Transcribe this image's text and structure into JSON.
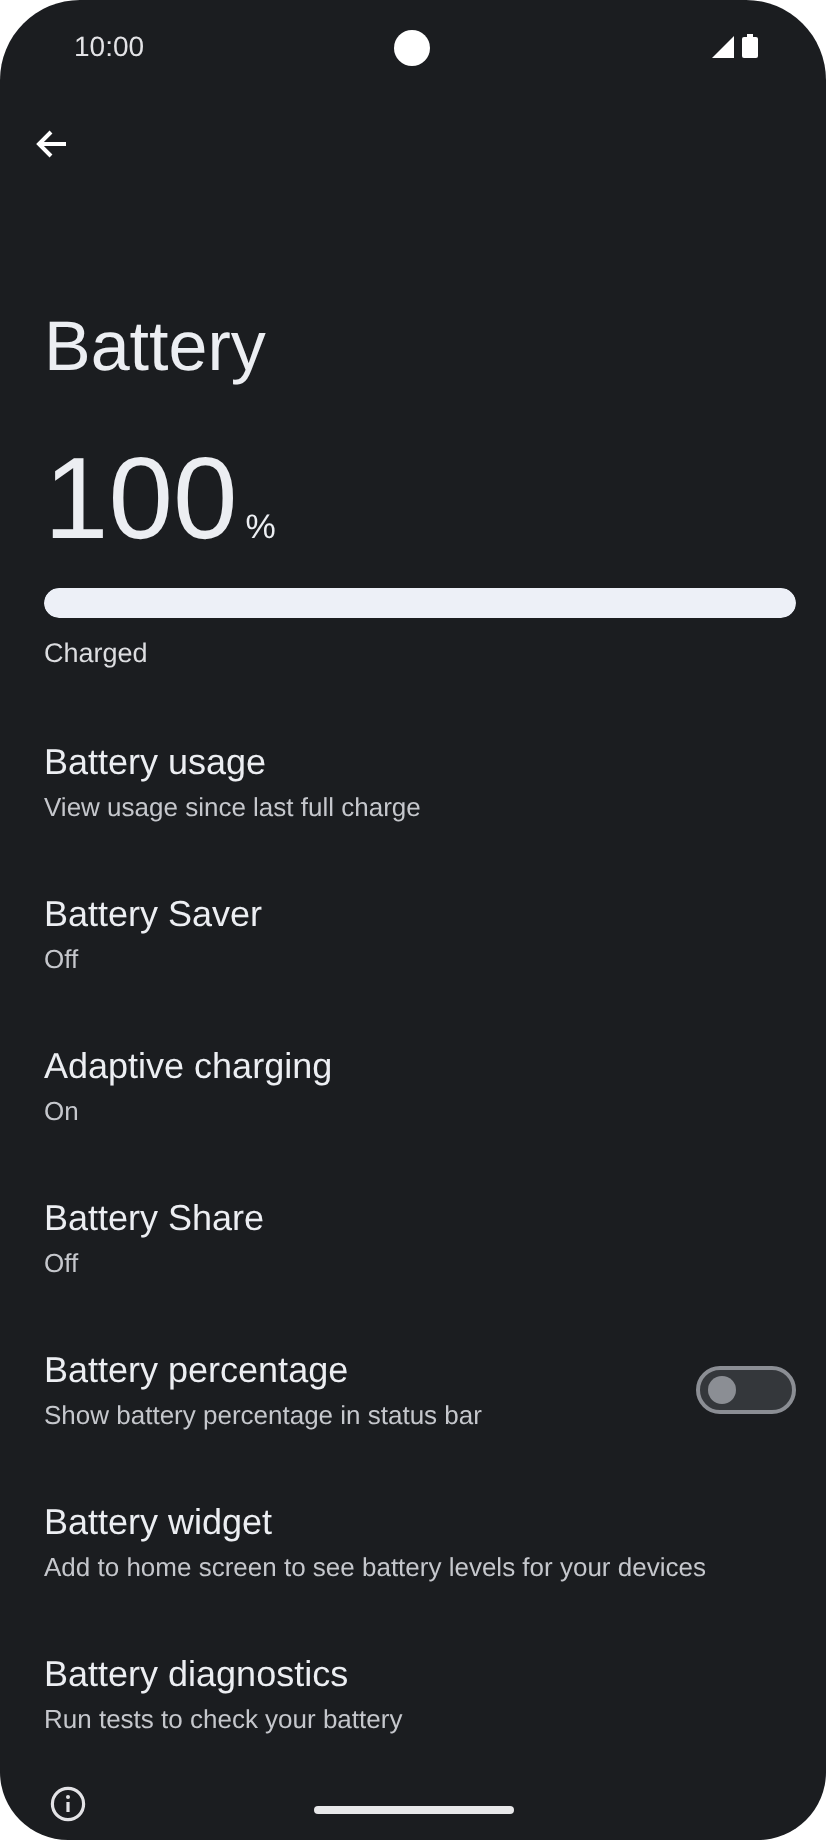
{
  "status_bar": {
    "time": "10:00"
  },
  "title": "Battery",
  "battery": {
    "percent": "100",
    "unit": "%",
    "level": 1.0,
    "status": "Charged"
  },
  "items": [
    {
      "kind": "text",
      "title": "Battery usage",
      "summary": "View usage since last full charge"
    },
    {
      "kind": "text",
      "title": "Battery Saver",
      "summary": "Off"
    },
    {
      "kind": "text",
      "title": "Adaptive charging",
      "summary": "On"
    },
    {
      "kind": "text",
      "title": "Battery Share",
      "summary": "Off"
    },
    {
      "kind": "switch",
      "title": "Battery percentage",
      "summary": "Show battery percentage in status bar",
      "on": false
    },
    {
      "kind": "text",
      "title": "Battery widget",
      "summary": "Add to home screen to see battery levels for your devices"
    },
    {
      "kind": "text",
      "title": "Battery diagnostics",
      "summary": "Run tests to check your battery"
    }
  ]
}
